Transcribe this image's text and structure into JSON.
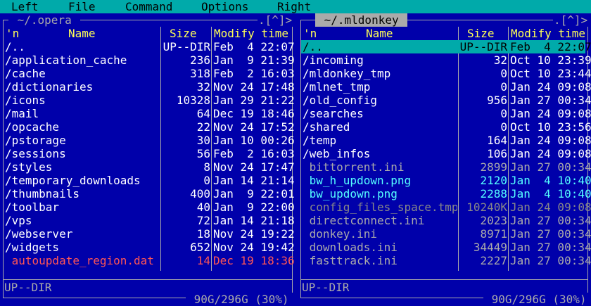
{
  "menu": [
    "Left",
    "File",
    "Command",
    "Options",
    "Right"
  ],
  "left_panel": {
    "path": " ~/.opera ",
    "hint": ".[^]>",
    "headers": {
      "sort": "'n",
      "name": "Name",
      "size": "Size",
      "modify": "Modify time"
    },
    "rows": [
      {
        "name": "/..",
        "size": "UP--DIR",
        "date": "Feb  4 22:07",
        "style": "dir"
      },
      {
        "name": "/application_cache",
        "size": "236",
        "date": "Jan  9 21:39",
        "style": "dir"
      },
      {
        "name": "/cache",
        "size": "318",
        "date": "Feb  2 16:03",
        "style": "dir"
      },
      {
        "name": "/dictionaries",
        "size": "32",
        "date": "Nov 24 17:48",
        "style": "dir"
      },
      {
        "name": "/icons",
        "size": "10328",
        "date": "Jan 29 21:22",
        "style": "dir"
      },
      {
        "name": "/mail",
        "size": "64",
        "date": "Dec 19 18:46",
        "style": "dir"
      },
      {
        "name": "/opcache",
        "size": "22",
        "date": "Nov 24 17:52",
        "style": "dir"
      },
      {
        "name": "/pstorage",
        "size": "30",
        "date": "Jan 10 00:26",
        "style": "dir"
      },
      {
        "name": "/sessions",
        "size": "56",
        "date": "Feb  2 16:03",
        "style": "dir"
      },
      {
        "name": "/styles",
        "size": "8",
        "date": "Nov 24 17:47",
        "style": "dir"
      },
      {
        "name": "/temporary_downloads",
        "size": "0",
        "date": "Jan 14 21:14",
        "style": "dir"
      },
      {
        "name": "/thumbnails",
        "size": "400",
        "date": "Jan  9 22:01",
        "style": "dir"
      },
      {
        "name": "/toolbar",
        "size": "40",
        "date": "Jan  9 22:00",
        "style": "dir"
      },
      {
        "name": "/vps",
        "size": "72",
        "date": "Jan 14 21:18",
        "style": "dir"
      },
      {
        "name": "/webserver",
        "size": "18",
        "date": "Nov 24 19:22",
        "style": "dir"
      },
      {
        "name": "/widgets",
        "size": "652",
        "date": "Nov 24 19:42",
        "style": "dir"
      },
      {
        "name": " autoupdate_region.dat",
        "size": "14",
        "date": "Dec 19 18:36",
        "style": "red"
      }
    ],
    "info": "UP--DIR",
    "free": " 90G/296G (30%) "
  },
  "right_panel": {
    "path": " ~/.mldonkey ",
    "hint": ".[^]>",
    "headers": {
      "sort": "'n",
      "name": "Name",
      "size": "Size",
      "modify": "Modify time"
    },
    "rows": [
      {
        "name": "/..",
        "size": "UP--DIR",
        "date": "Feb  4 22:07",
        "style": "sel"
      },
      {
        "name": "/incoming",
        "size": "32",
        "date": "Oct 10 23:39",
        "style": "dir"
      },
      {
        "name": "/mldonkey_tmp",
        "size": "0",
        "date": "Oct 10 23:44",
        "style": "dir"
      },
      {
        "name": "/mlnet_tmp",
        "size": "0",
        "date": "Jan 24 09:08",
        "style": "dir"
      },
      {
        "name": "/old_config",
        "size": "956",
        "date": "Jan 27 00:34",
        "style": "dir"
      },
      {
        "name": "/searches",
        "size": "0",
        "date": "Jan 24 09:08",
        "style": "dir"
      },
      {
        "name": "/shared",
        "size": "0",
        "date": "Oct 10 23:56",
        "style": "dir"
      },
      {
        "name": "/temp",
        "size": "164",
        "date": "Jan 24 09:08",
        "style": "dir"
      },
      {
        "name": "/web_infos",
        "size": "106",
        "date": "Jan 24 09:08",
        "style": "dir"
      },
      {
        "name": " bittorrent.ini",
        "size": "2899",
        "date": "Jan 27 00:34",
        "style": "dim"
      },
      {
        "name": " bw_h_updown.png",
        "size": "2120",
        "date": "Jan  4 10:40",
        "style": "hl"
      },
      {
        "name": " bw_updown.png",
        "size": "2288",
        "date": "Jan  4 10:40",
        "style": "hl"
      },
      {
        "name": " config_files_space.tmp",
        "size": "10240K",
        "date": "Jan 24 09:08",
        "style": "core"
      },
      {
        "name": " directconnect.ini",
        "size": "2023",
        "date": "Jan 27 00:34",
        "style": "dim"
      },
      {
        "name": " donkey.ini",
        "size": "8971",
        "date": "Jan 27 00:34",
        "style": "dim"
      },
      {
        "name": " downloads.ini",
        "size": "34449",
        "date": "Jan 27 00:34",
        "style": "dim"
      },
      {
        "name": " fasttrack.ini",
        "size": "2227",
        "date": "Jan 27 00:34",
        "style": "dim"
      }
    ],
    "info": "UP--DIR",
    "free": " 90G/296G (30%) "
  }
}
